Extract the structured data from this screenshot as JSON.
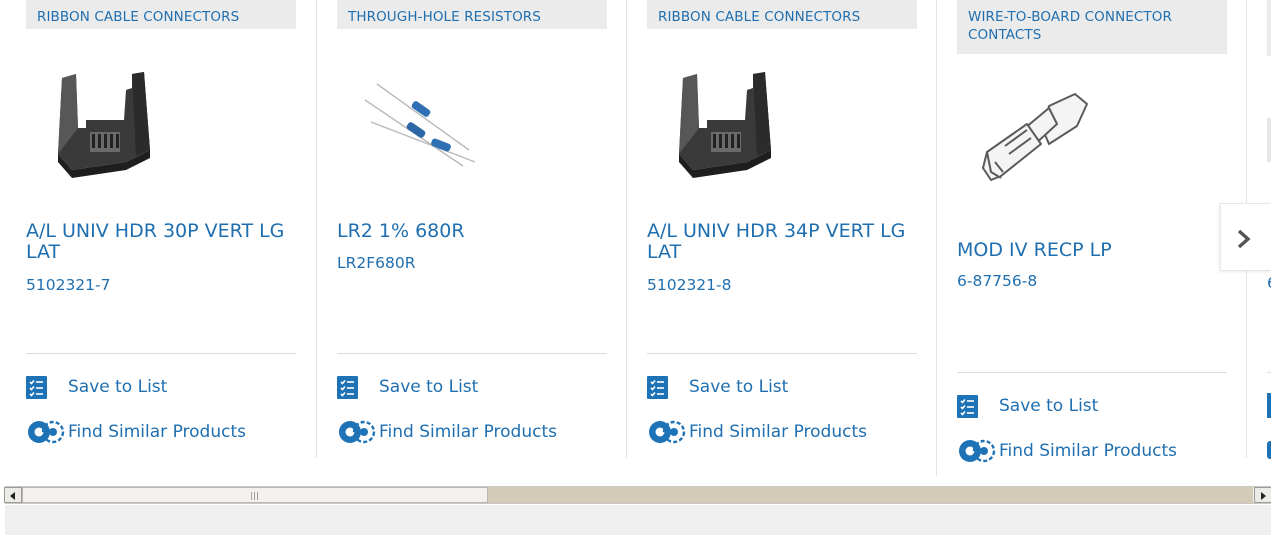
{
  "colors": {
    "link": "#1f6fb0",
    "category_bg": "#ebebeb",
    "icon_blue": "#1e72b6"
  },
  "products": [
    {
      "category": "RIBBON CABLE CONNECTORS",
      "title": "A/L UNIV HDR 30P VERT LG LAT",
      "part_number": "5102321-7",
      "image": "ribbon-cable-connector-image",
      "save_label": "Save to List",
      "similar_label": "Find Similar Products"
    },
    {
      "category": "THROUGH-HOLE RESISTORS",
      "title": "LR2 1% 680R",
      "part_number": "LR2F680R",
      "image": "through-hole-resistor-image",
      "save_label": "Save to List",
      "similar_label": "Find Similar Products"
    },
    {
      "category": "RIBBON CABLE CONNECTORS",
      "title": "A/L UNIV HDR 34P VERT LG LAT",
      "part_number": "5102321-8",
      "image": "ribbon-cable-connector-image",
      "save_label": "Save to List",
      "similar_label": "Find Similar Products"
    },
    {
      "category": "WIRE-TO-BOARD CONNECTOR CONTACTS",
      "title": "MOD IV RECP LP",
      "part_number": "6-87756-8",
      "image": "crimp-contact-image",
      "save_label": "Save to List",
      "similar_label": "Find Similar Products"
    },
    {
      "part_number_partial": "6"
    }
  ],
  "navigation": {
    "next_icon": "chevron-right-icon"
  },
  "scrollbar": {
    "left_icon": "arrow-left-icon",
    "right_icon": "arrow-right-icon",
    "position": 0.38
  }
}
